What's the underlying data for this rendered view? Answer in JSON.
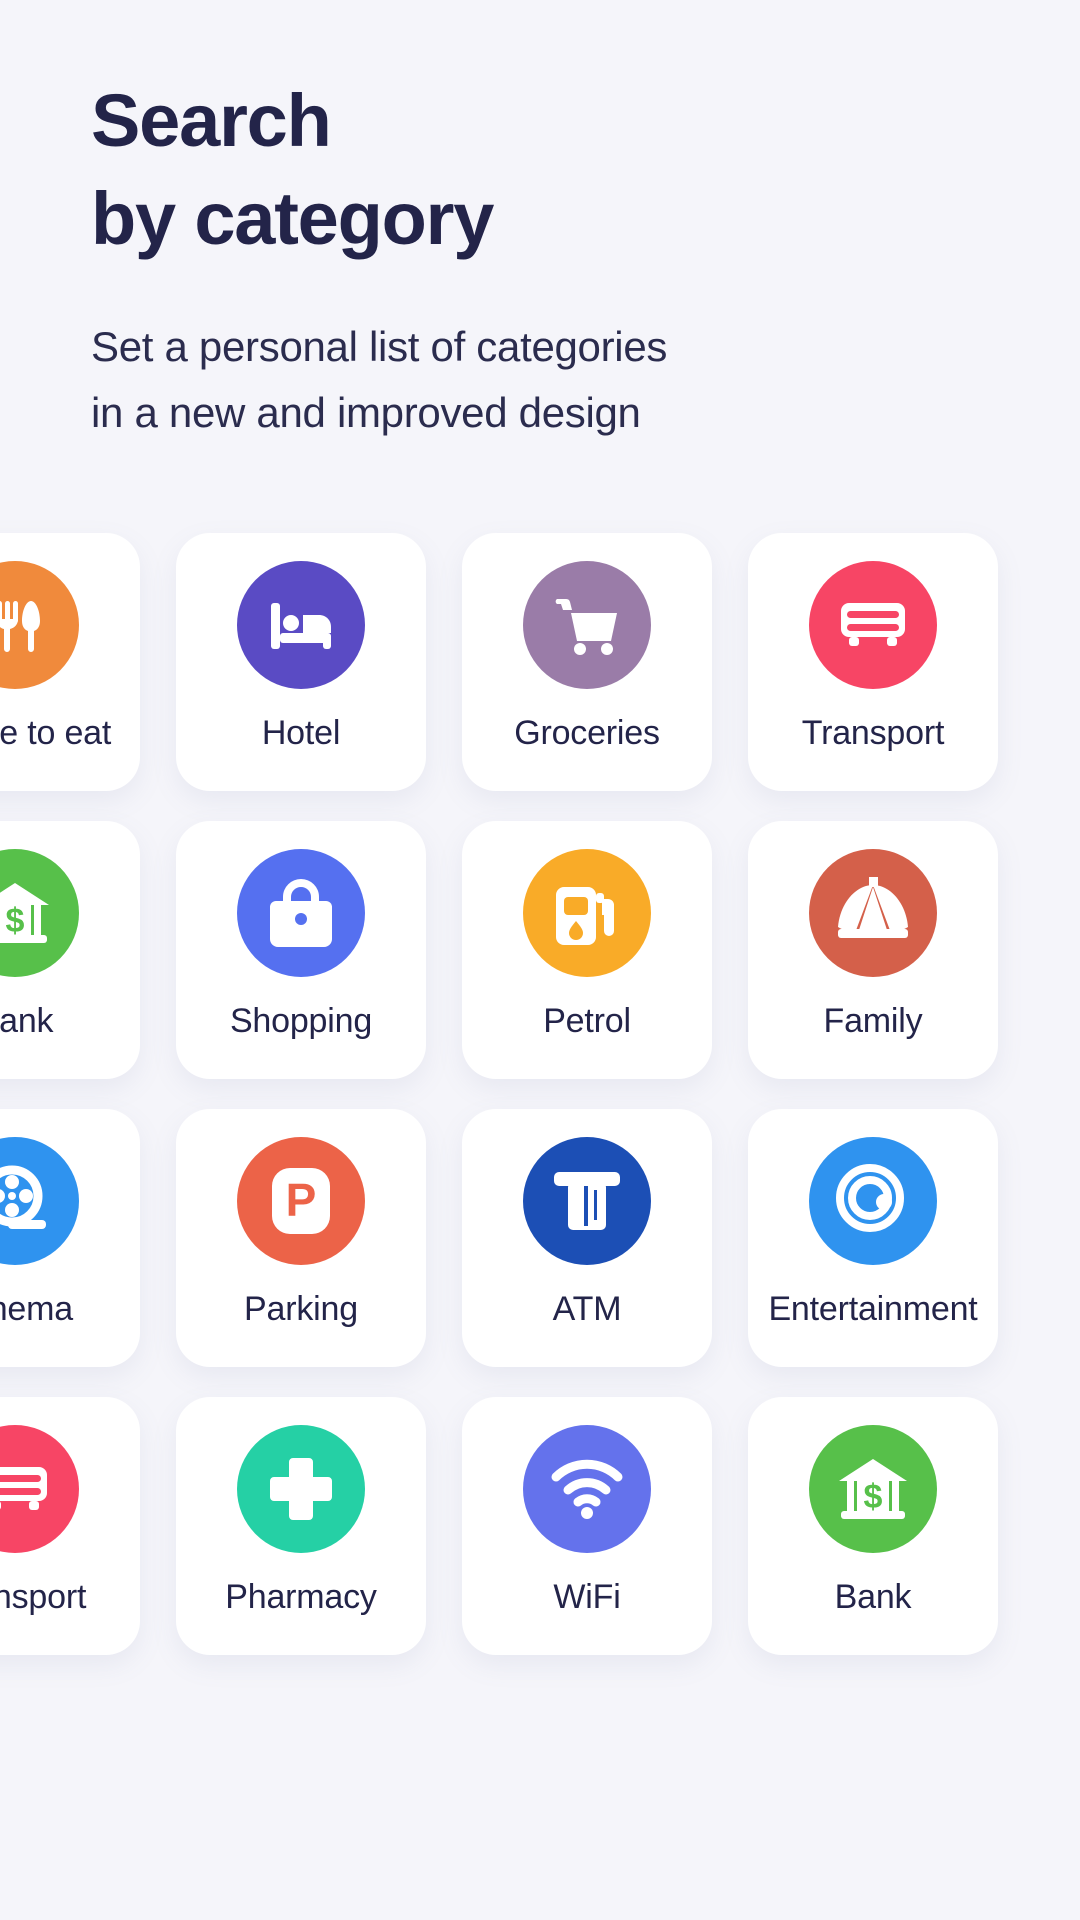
{
  "header": {
    "title_line1": "Search",
    "title_line2": "by category",
    "subtitle_line1": "Set a personal list of categories",
    "subtitle_line2": "in a new and improved design"
  },
  "colors": {
    "background": "#f5f5fa",
    "card": "#ffffff",
    "text": "#232449"
  },
  "grid": {
    "rows": [
      {
        "cards": [
          {
            "label": "Where to eat",
            "icon": "cutlery-icon",
            "color": "#f08a3c"
          },
          {
            "label": "Hotel",
            "icon": "bed-icon",
            "color": "#5a4bc4"
          },
          {
            "label": "Groceries",
            "icon": "shopping-cart-icon",
            "color": "#9a7ca8"
          },
          {
            "label": "Transport",
            "icon": "bus-icon",
            "color": "#f74565"
          }
        ]
      },
      {
        "cards": [
          {
            "label": "Bank",
            "icon": "bank-icon",
            "color": "#57c04a"
          },
          {
            "label": "Shopping",
            "icon": "shopping-bag-icon",
            "color": "#5570f0"
          },
          {
            "label": "Petrol",
            "icon": "fuel-pump-icon",
            "color": "#f9ab28"
          },
          {
            "label": "Family",
            "icon": "circus-tent-icon",
            "color": "#d4604a"
          }
        ]
      },
      {
        "cards": [
          {
            "label": "Cinema",
            "icon": "film-reel-icon",
            "color": "#2f93ef"
          },
          {
            "label": "Parking",
            "icon": "parking-icon",
            "color": "#ec6348"
          },
          {
            "label": "ATM",
            "icon": "atm-icon",
            "color": "#1c4fb5"
          },
          {
            "label": "Entertainment",
            "icon": "disc-icon",
            "color": "#2f93ef"
          }
        ]
      },
      {
        "cards": [
          {
            "label": "Transport",
            "icon": "bus-icon",
            "color": "#f74565"
          },
          {
            "label": "Pharmacy",
            "icon": "cross-icon",
            "color": "#25d0a5"
          },
          {
            "label": "WiFi",
            "icon": "wifi-icon",
            "color": "#6472ec"
          },
          {
            "label": "Bank",
            "icon": "bank-icon",
            "color": "#57c04a"
          }
        ]
      }
    ]
  }
}
